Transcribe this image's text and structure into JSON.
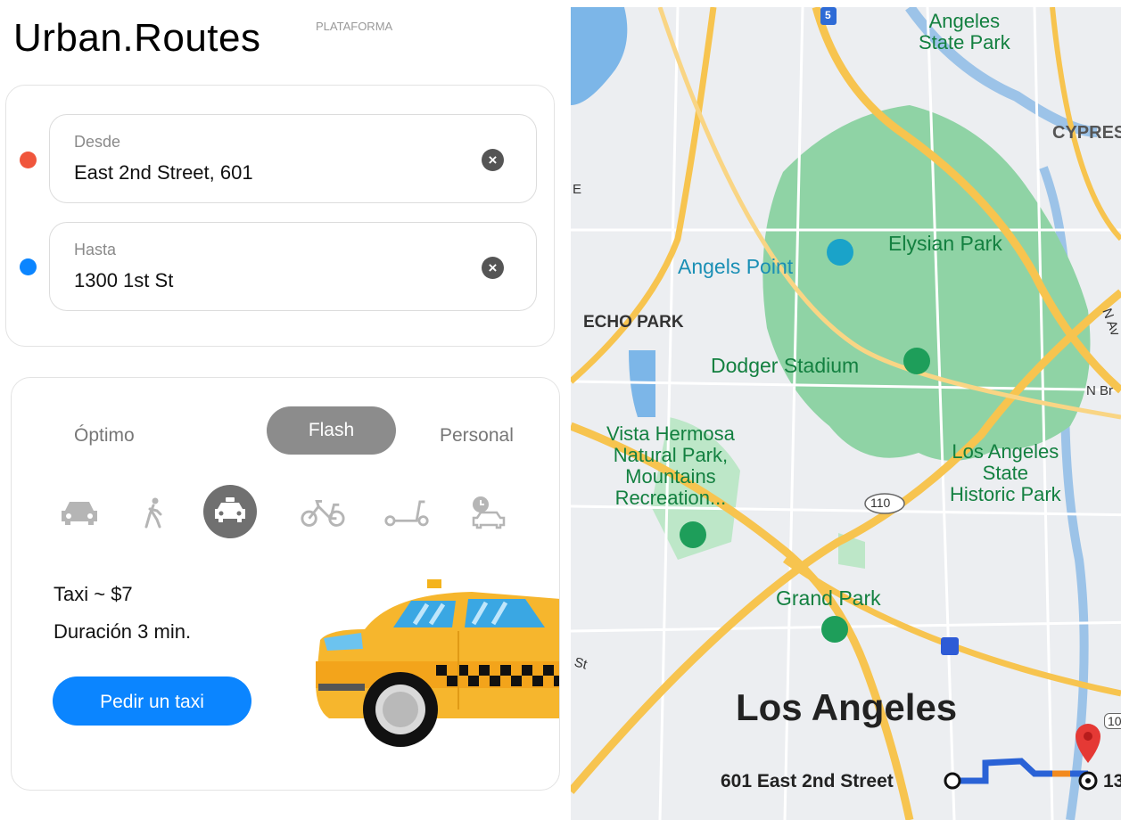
{
  "app": {
    "logo_main": "Urban.",
    "logo_brand": "Routes",
    "badge": "PLATAFORMA"
  },
  "route": {
    "from": {
      "label": "Desde",
      "value": "East 2nd Street, 601",
      "dot_color": "#f0563c"
    },
    "to": {
      "label": "Hasta",
      "value": "1300 1st St",
      "dot_color": "#0b85ff"
    }
  },
  "tariffs": {
    "modes": [
      "Óptimo",
      "Flash",
      "Personal"
    ],
    "active_mode": "Flash",
    "transport_icons": [
      "car-icon",
      "walk-icon",
      "taxi-icon",
      "bike-icon",
      "scooter-icon",
      "drive-icon"
    ],
    "active_transport": "taxi-icon",
    "price_text": "Taxi ~ $7",
    "duration_text": "Duración 3 min.",
    "order_button": "Pedir un taxi"
  },
  "map": {
    "labels": {
      "angeles_state_park_1": "Angeles",
      "angeles_state_park_2": "State Park",
      "cypress": "CYPRES",
      "elysian": "Elysian Park",
      "angels_point": "Angels Point",
      "echo_park": "ECHO PARK",
      "dodger": "Dodger Stadium",
      "vista1": "Vista Hermosa",
      "vista2": "Natural Park,",
      "vista3": "Mountains",
      "vista4": "Recreation...",
      "la_state1": "Los Angeles",
      "la_state2": "State",
      "la_state3": "Historic Park",
      "grand_park": "Grand Park",
      "los_angeles": "Los Angeles",
      "start": "601 East 2nd Street",
      "end_partial": "13",
      "hwy_110": "110",
      "hwy_5": "5",
      "n_br": "N Br",
      "st_edge": "St",
      "n_av": "N Av",
      "e_edge": "E",
      "hwy_edge": "10"
    }
  }
}
